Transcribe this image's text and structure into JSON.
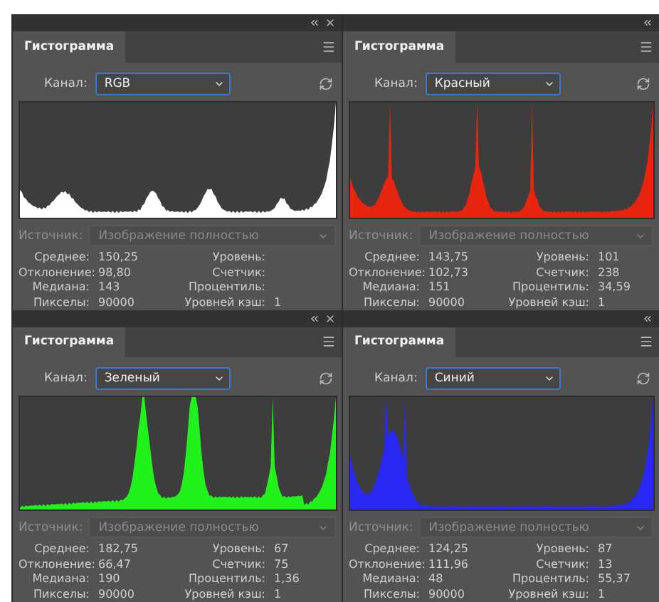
{
  "panels": [
    {
      "tab": {
        "label": "Гистограмма",
        "selected": true
      },
      "close_button": true,
      "channel": {
        "label": "Канал:",
        "value": "RGB"
      },
      "color": "#ffffff",
      "source": {
        "label": "Источник:",
        "value": "Изображение полностью",
        "disabled": true
      },
      "stats_left": [
        {
          "label": "Среднее:",
          "value": "150,25"
        },
        {
          "label": "Отклонение:",
          "value": "98,80"
        },
        {
          "label": "Медиана:",
          "value": "143"
        },
        {
          "label": "Пикселы:",
          "value": "90000"
        }
      ],
      "stats_right": [
        {
          "label": "Уровень:"
        },
        {
          "label": "Счетчик:"
        },
        {
          "label": "Процентиль:"
        },
        {
          "label": "Уровней кэш:",
          "value": "1"
        }
      ]
    },
    {
      "tab": {
        "label": "Гистограмма",
        "selected": true
      },
      "close_button": false,
      "channel": {
        "label": "Канал:",
        "value": "Красный"
      },
      "color": "#e8250f",
      "source": {
        "label": "Источник:",
        "value": "Изображение полностью",
        "disabled": true
      },
      "stats_left": [
        {
          "label": "Среднее:",
          "value": "143,75"
        },
        {
          "label": "Отклонение:",
          "value": "102,73"
        },
        {
          "label": "Медиана:",
          "value": "151"
        },
        {
          "label": "Пикселы:",
          "value": "90000"
        }
      ],
      "stats_right": [
        {
          "label": "Уровень:",
          "value": "101"
        },
        {
          "label": "Счетчик:",
          "value": "238"
        },
        {
          "label": "Процентиль:",
          "value": "34,59"
        },
        {
          "label": "Уровней кэш:",
          "value": "1"
        }
      ]
    },
    {
      "tab": {
        "label": "Гистограмма",
        "selected": true
      },
      "close_button": true,
      "channel": {
        "label": "Канал:",
        "value": "Зеленый"
      },
      "color": "#22f21c",
      "source": {
        "label": "Источник:",
        "value": "Изображение полностью",
        "disabled": true
      },
      "stats_left": [
        {
          "label": "Среднее:",
          "value": "182,75"
        },
        {
          "label": "Отклонение:",
          "value": "66,47"
        },
        {
          "label": "Медиана:",
          "value": "190"
        },
        {
          "label": "Пикселы:",
          "value": "90000"
        }
      ],
      "stats_right": [
        {
          "label": "Уровень:",
          "value": "67"
        },
        {
          "label": "Счетчик:",
          "value": "75"
        },
        {
          "label": "Процентиль:",
          "value": "1,36"
        },
        {
          "label": "Уровней кэш:",
          "value": "1"
        }
      ]
    },
    {
      "tab": {
        "label": "Гистограмма",
        "selected": true
      },
      "close_button": false,
      "channel": {
        "label": "Канал:",
        "value": "Синий"
      },
      "color": "#2a28f5",
      "source": {
        "label": "Источник:",
        "value": "Изображение полностью",
        "disabled": true
      },
      "stats_left": [
        {
          "label": "Среднее:",
          "value": "124,25"
        },
        {
          "label": "Отклонение:",
          "value": "111,96"
        },
        {
          "label": "Медиана:",
          "value": "48"
        },
        {
          "label": "Пикселы:",
          "value": "90000"
        }
      ],
      "stats_right": [
        {
          "label": "Уровень:",
          "value": "87"
        },
        {
          "label": "Счетчик:",
          "value": "13"
        },
        {
          "label": "Процентиль:",
          "value": "55,37"
        },
        {
          "label": "Уровней кэш:",
          "value": "1"
        }
      ]
    }
  ]
}
